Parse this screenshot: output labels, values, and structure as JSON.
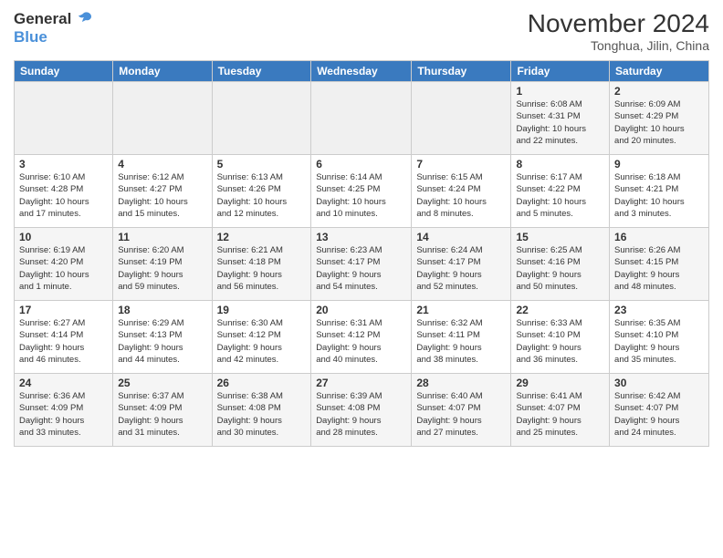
{
  "logo": {
    "line1": "General",
    "line2": "Blue"
  },
  "title": "November 2024",
  "location": "Tonghua, Jilin, China",
  "days_of_week": [
    "Sunday",
    "Monday",
    "Tuesday",
    "Wednesday",
    "Thursday",
    "Friday",
    "Saturday"
  ],
  "weeks": [
    [
      {
        "day": "",
        "info": ""
      },
      {
        "day": "",
        "info": ""
      },
      {
        "day": "",
        "info": ""
      },
      {
        "day": "",
        "info": ""
      },
      {
        "day": "",
        "info": ""
      },
      {
        "day": "1",
        "info": "Sunrise: 6:08 AM\nSunset: 4:31 PM\nDaylight: 10 hours\nand 22 minutes."
      },
      {
        "day": "2",
        "info": "Sunrise: 6:09 AM\nSunset: 4:29 PM\nDaylight: 10 hours\nand 20 minutes."
      }
    ],
    [
      {
        "day": "3",
        "info": "Sunrise: 6:10 AM\nSunset: 4:28 PM\nDaylight: 10 hours\nand 17 minutes."
      },
      {
        "day": "4",
        "info": "Sunrise: 6:12 AM\nSunset: 4:27 PM\nDaylight: 10 hours\nand 15 minutes."
      },
      {
        "day": "5",
        "info": "Sunrise: 6:13 AM\nSunset: 4:26 PM\nDaylight: 10 hours\nand 12 minutes."
      },
      {
        "day": "6",
        "info": "Sunrise: 6:14 AM\nSunset: 4:25 PM\nDaylight: 10 hours\nand 10 minutes."
      },
      {
        "day": "7",
        "info": "Sunrise: 6:15 AM\nSunset: 4:24 PM\nDaylight: 10 hours\nand 8 minutes."
      },
      {
        "day": "8",
        "info": "Sunrise: 6:17 AM\nSunset: 4:22 PM\nDaylight: 10 hours\nand 5 minutes."
      },
      {
        "day": "9",
        "info": "Sunrise: 6:18 AM\nSunset: 4:21 PM\nDaylight: 10 hours\nand 3 minutes."
      }
    ],
    [
      {
        "day": "10",
        "info": "Sunrise: 6:19 AM\nSunset: 4:20 PM\nDaylight: 10 hours\nand 1 minute."
      },
      {
        "day": "11",
        "info": "Sunrise: 6:20 AM\nSunset: 4:19 PM\nDaylight: 9 hours\nand 59 minutes."
      },
      {
        "day": "12",
        "info": "Sunrise: 6:21 AM\nSunset: 4:18 PM\nDaylight: 9 hours\nand 56 minutes."
      },
      {
        "day": "13",
        "info": "Sunrise: 6:23 AM\nSunset: 4:17 PM\nDaylight: 9 hours\nand 54 minutes."
      },
      {
        "day": "14",
        "info": "Sunrise: 6:24 AM\nSunset: 4:17 PM\nDaylight: 9 hours\nand 52 minutes."
      },
      {
        "day": "15",
        "info": "Sunrise: 6:25 AM\nSunset: 4:16 PM\nDaylight: 9 hours\nand 50 minutes."
      },
      {
        "day": "16",
        "info": "Sunrise: 6:26 AM\nSunset: 4:15 PM\nDaylight: 9 hours\nand 48 minutes."
      }
    ],
    [
      {
        "day": "17",
        "info": "Sunrise: 6:27 AM\nSunset: 4:14 PM\nDaylight: 9 hours\nand 46 minutes."
      },
      {
        "day": "18",
        "info": "Sunrise: 6:29 AM\nSunset: 4:13 PM\nDaylight: 9 hours\nand 44 minutes."
      },
      {
        "day": "19",
        "info": "Sunrise: 6:30 AM\nSunset: 4:12 PM\nDaylight: 9 hours\nand 42 minutes."
      },
      {
        "day": "20",
        "info": "Sunrise: 6:31 AM\nSunset: 4:12 PM\nDaylight: 9 hours\nand 40 minutes."
      },
      {
        "day": "21",
        "info": "Sunrise: 6:32 AM\nSunset: 4:11 PM\nDaylight: 9 hours\nand 38 minutes."
      },
      {
        "day": "22",
        "info": "Sunrise: 6:33 AM\nSunset: 4:10 PM\nDaylight: 9 hours\nand 36 minutes."
      },
      {
        "day": "23",
        "info": "Sunrise: 6:35 AM\nSunset: 4:10 PM\nDaylight: 9 hours\nand 35 minutes."
      }
    ],
    [
      {
        "day": "24",
        "info": "Sunrise: 6:36 AM\nSunset: 4:09 PM\nDaylight: 9 hours\nand 33 minutes."
      },
      {
        "day": "25",
        "info": "Sunrise: 6:37 AM\nSunset: 4:09 PM\nDaylight: 9 hours\nand 31 minutes."
      },
      {
        "day": "26",
        "info": "Sunrise: 6:38 AM\nSunset: 4:08 PM\nDaylight: 9 hours\nand 30 minutes."
      },
      {
        "day": "27",
        "info": "Sunrise: 6:39 AM\nSunset: 4:08 PM\nDaylight: 9 hours\nand 28 minutes."
      },
      {
        "day": "28",
        "info": "Sunrise: 6:40 AM\nSunset: 4:07 PM\nDaylight: 9 hours\nand 27 minutes."
      },
      {
        "day": "29",
        "info": "Sunrise: 6:41 AM\nSunset: 4:07 PM\nDaylight: 9 hours\nand 25 minutes."
      },
      {
        "day": "30",
        "info": "Sunrise: 6:42 AM\nSunset: 4:07 PM\nDaylight: 9 hours\nand 24 minutes."
      }
    ]
  ]
}
